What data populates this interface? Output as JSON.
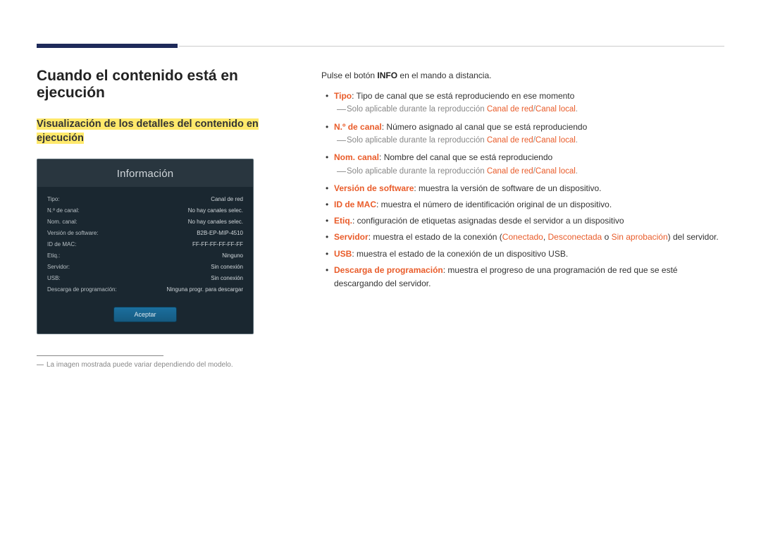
{
  "header": {
    "title": "Cuando el contenido está en ejecución",
    "subtitle_line1": "Visualización de los detalles del contenido en",
    "subtitle_line2": "ejecución"
  },
  "panel": {
    "title": "Información",
    "rows": [
      {
        "k": "Tipo:",
        "v": "Canal de red"
      },
      {
        "k": "N.º de canal:",
        "v": "No hay canales selec."
      },
      {
        "k": "Nom. canal:",
        "v": "No hay canales selec."
      },
      {
        "k": "Versión de software:",
        "v": "B2B-EP-MIP-4510"
      },
      {
        "k": "ID de MAC:",
        "v": "FF-FF-FF-FF-FF-FF"
      },
      {
        "k": "Etiq.:",
        "v": "Ninguno"
      },
      {
        "k": "Servidor:",
        "v": "Sin conexión"
      },
      {
        "k": "USB:",
        "v": "Sin conexión"
      },
      {
        "k": "Descarga de programación:",
        "v": "Ninguna progr. para descargar"
      }
    ],
    "accept": "Aceptar"
  },
  "footnote": "La imagen mostrada puede variar dependiendo del modelo.",
  "right": {
    "intro_pre": "Pulse el botón ",
    "intro_bold": "INFO",
    "intro_post": " en el mando a distancia.",
    "items": {
      "tipo_label": "Tipo",
      "tipo_text": ": Tipo de canal que se está reproduciendo en ese momento",
      "sub_applies_pre": "Solo aplicable durante la reproducción ",
      "sub_applies_ch1": "Canal de red",
      "sub_applies_sep": "/",
      "sub_applies_ch2": "Canal local",
      "sub_applies_dot": ".",
      "ncanal_label": "N.º de canal",
      "ncanal_text": ": Número asignado al canal que se está reproduciendo",
      "nomcanal_label": "Nom. canal",
      "nomcanal_text": ": Nombre del canal que se está reproduciendo",
      "version_label": "Versión de software",
      "version_text": ": muestra la versión de software de un dispositivo.",
      "mac_label": "ID de MAC",
      "mac_text": ": muestra el número de identificación original de un dispositivo.",
      "etiq_label": "Etiq.",
      "etiq_text": ": configuración de etiquetas asignadas desde el servidor a un dispositivo",
      "servidor_label": "Servidor",
      "servidor_pre": ": muestra el estado de la conexión (",
      "servidor_s1": "Conectado",
      "servidor_c1": ", ",
      "servidor_s2": "Desconectada",
      "servidor_c2": " o ",
      "servidor_s3": "Sin aprobación",
      "servidor_post": ") del servidor.",
      "usb_label": "USB",
      "usb_text": ": muestra el estado de la conexión de un dispositivo USB.",
      "descarga_label": "Descarga de programación",
      "descarga_text": ": muestra el progreso de una programación de red que se esté descargando del servidor."
    }
  }
}
